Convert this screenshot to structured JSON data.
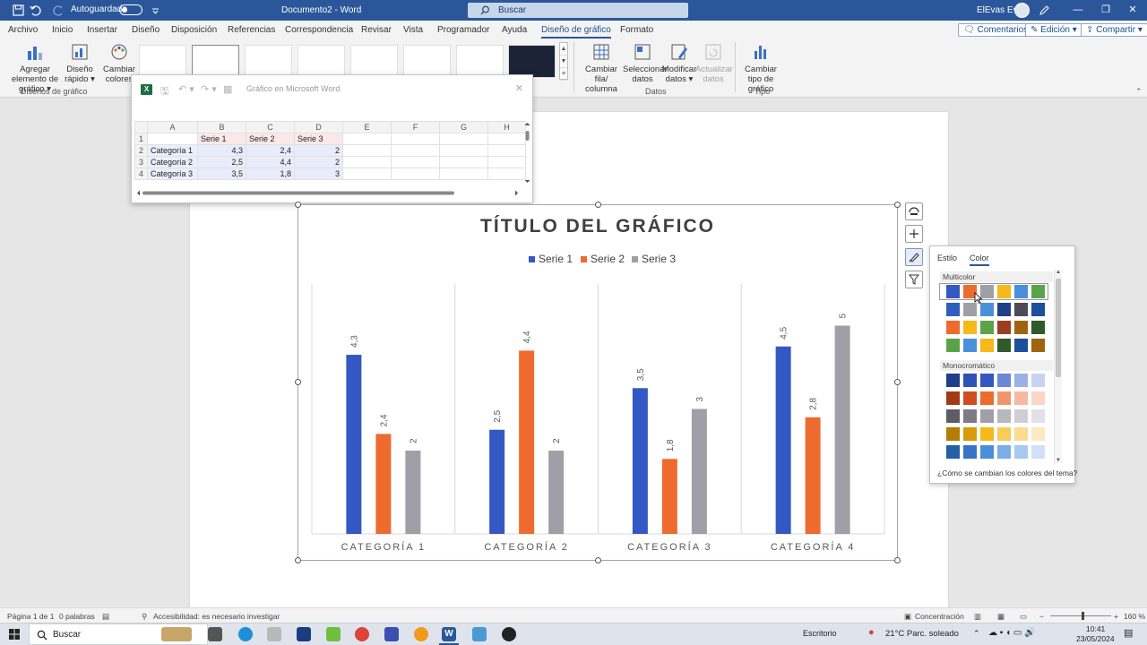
{
  "titlebar": {
    "autosave_label": "Autoguardado",
    "doc_title": "Documento2 - Word",
    "search_placeholder": "Buscar",
    "user_name": "ElEvas Evas"
  },
  "tabs": [
    "Archivo",
    "Inicio",
    "Insertar",
    "Diseño",
    "Disposición",
    "Referencias",
    "Correspondencia",
    "Revisar",
    "Vista",
    "Programador",
    "Ayuda",
    "Diseño de gráfico",
    "Formato"
  ],
  "active_tab": "Diseño de gráfico",
  "ribbon_right": {
    "comments": "Comentarios",
    "editing": "Edición",
    "share": "Compartir"
  },
  "ribbon": {
    "add_element": "Agregar elemento de gráfico",
    "quick_layout": "Diseño rápido",
    "change_colors": "Cambiar colores",
    "group_layouts": "Diseños de gráfico",
    "switch_row_col": "Cambiar fila/ columna",
    "select_data": "Seleccionar datos",
    "edit_data": "Modificar datos",
    "refresh_data": "Actualizar datos",
    "group_data": "Datos",
    "change_type": "Cambiar tipo de gráfico",
    "group_type": "Tipo"
  },
  "excel": {
    "title": "Gráfico en Microsoft Word",
    "columns": [
      "A",
      "B",
      "C",
      "D",
      "E",
      "F",
      "G",
      "H"
    ],
    "rows": [
      [
        "1",
        "",
        "Serie 1",
        "Serie 2",
        "Serie 3"
      ],
      [
        "2",
        "Categoría 1",
        "4,3",
        "2,4",
        "2"
      ],
      [
        "3",
        "Categoría 2",
        "2,5",
        "4,4",
        "2"
      ],
      [
        "4",
        "Categoría 3",
        "3,5",
        "1,8",
        "3"
      ]
    ]
  },
  "chart_data": {
    "type": "bar",
    "title": "TÍTULO DEL GRÁFICO",
    "categories": [
      "CATEGORÍA 1",
      "CATEGORÍA 2",
      "CATEGORÍA 3",
      "CATEGORÍA 4"
    ],
    "series": [
      {
        "name": "Serie 1",
        "values": [
          4.3,
          2.5,
          3.5,
          4.5
        ],
        "labels": [
          "4,3",
          "2,5",
          "3,5",
          "4,5"
        ],
        "color": "#3358c4"
      },
      {
        "name": "Serie 2",
        "values": [
          2.4,
          4.4,
          1.8,
          2.8
        ],
        "labels": [
          "2,4",
          "4,4",
          "1,8",
          "2,8"
        ],
        "color": "#ee6b2f"
      },
      {
        "name": "Serie 3",
        "values": [
          2,
          2,
          3,
          5
        ],
        "labels": [
          "2",
          "2",
          "3",
          "5"
        ],
        "color": "#a09fa7"
      }
    ],
    "ylim": [
      0,
      6
    ],
    "legend": "top",
    "grid": "vertical"
  },
  "color_panel": {
    "tabs": [
      "Estilo",
      "Color"
    ],
    "active_tab": "Color",
    "section_multicolor": "Multicolor",
    "section_mono": "Monocromático",
    "multicolor_rows": [
      [
        "#3358c4",
        "#ee6b2f",
        "#a09fa7",
        "#f6b81a",
        "#4a8fd9",
        "#5ba34a"
      ],
      [
        "#2f5ec0",
        "#a09fa7",
        "#4a8fd9",
        "#1f3f8a",
        "#4d4a5c",
        "#1e4f9a"
      ],
      [
        "#ee6b2f",
        "#f6b81a",
        "#5ba34a",
        "#9c3d1f",
        "#a0640f",
        "#2f5b2a"
      ],
      [
        "#5ba34a",
        "#4a8fd9",
        "#f6b81a",
        "#2f5b2a",
        "#1e4f9a",
        "#a0640f"
      ]
    ],
    "mono_rows": [
      [
        "#1f3f8a",
        "#2f52b3",
        "#3358c4",
        "#6a87d8",
        "#9cb0e6",
        "#c8d3f1"
      ],
      [
        "#a33a17",
        "#cf4e1f",
        "#ee6b2f",
        "#f29470",
        "#f6b9a2",
        "#fad6ca"
      ],
      [
        "#5e5c66",
        "#7d7b86",
        "#a09fa7",
        "#b8b7bd",
        "#cfced3",
        "#e2e1e5"
      ],
      [
        "#b37d05",
        "#d89a0a",
        "#f6b81a",
        "#f8cb5a",
        "#fadb90",
        "#fde9bf"
      ],
      [
        "#255fa8",
        "#3575c4",
        "#4a8fd9",
        "#7aaee6",
        "#a7c9ef",
        "#cfe0f7"
      ]
    ],
    "help_link": "¿Cómo se cambian los colores del tema?"
  },
  "statusbar": {
    "page": "Página 1 de 1",
    "words": "0 palabras",
    "accessibility": "Accesibilidad: es necesario investigar",
    "focus": "Concentración",
    "zoom": "160 %"
  },
  "taskbar": {
    "search": "Buscar",
    "desktop": "Escritorio",
    "weather": "21°C  Parc. soleado",
    "time": "10:41",
    "date": "23/05/2024"
  }
}
